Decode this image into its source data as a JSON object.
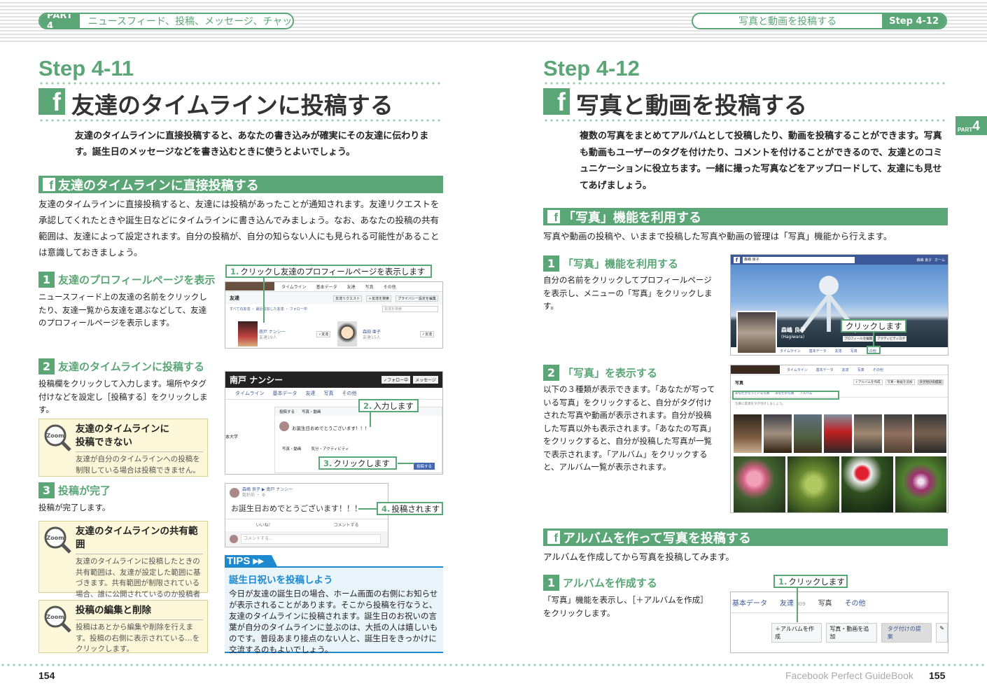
{
  "header": {
    "part_label": "PART 4",
    "left_title": "ニュースフィード、投稿、メッセージ、チャット",
    "right_title": "写真と動画を投稿する",
    "right_step": "Step 4-12"
  },
  "left": {
    "step": "Step 4-11",
    "title": "友達のタイムラインに投稿する",
    "intro": "友達のタイムラインに直接投稿すると、あなたの書き込みが確実にその友達に伝わります。誕生日のメッセージなどを書き込むときに使うとよいでしょう。",
    "section_title": "友達のタイムラインに直接投稿する",
    "section_body": "友達のタイムラインに直接投稿すると、友達には投稿があったことが通知されます。友達リクエストを承認してくれたときや誕生日などにタイムラインに書き込んでみましょう。なお、あなたの投稿の共有範囲は、友達によって設定されます。自分の投稿が、自分の知らない人にも見られる可能性があることは意識しておきましょう。",
    "steps": [
      {
        "num": "1",
        "title": "友達のプロフィールページを表示",
        "body": "ニュースフィード上の友達の名前をクリックしたり、友達一覧から友達を選ぶなどして、友達のプロフィールページを表示します。"
      },
      {
        "num": "2",
        "title": "友達のタイムラインに投稿する",
        "body": "投稿欄をクリックして入力します。場所やタグ付けなどを設定し［投稿する］をクリックします。"
      },
      {
        "num": "3",
        "title": "投稿が完了",
        "body": "投稿が完了します。"
      }
    ],
    "callouts": [
      {
        "num": "1.",
        "text": "クリックし友達のプロフィールページを表示します"
      },
      {
        "num": "2.",
        "text": "入力します"
      },
      {
        "num": "3.",
        "text": "クリックします"
      },
      {
        "num": "4.",
        "text": "投稿されます"
      }
    ],
    "zooms": [
      {
        "title": "友達のタイムラインに投稿できない",
        "title_l1": "友達のタイムラインに",
        "title_l2": "投稿できない",
        "body": "友達が自分のタイムラインへの投稿を制限している場合は投稿できません。"
      },
      {
        "title": "友達のタイムラインの共有範囲",
        "body": "友達のタイムラインに投稿したときの共有範囲は、友達が設定した範囲に基づきます。共有範囲が制限されている場合、誰に公開されているのか投稿者にはわかりません。"
      },
      {
        "title": "投稿の編集と削除",
        "body": "投稿はあとから編集や削除を行えます。投稿の右側に表示されている…をクリックします。"
      }
    ],
    "zoom_label": "Zoom",
    "tips": {
      "label": "TIPS",
      "title": "誕生日祝いを投稿しよう",
      "body": "今日が友達の誕生日の場合、ホーム画面の右側にお知らせが表示されることがあります。そこから投稿を行なうと、友達のタイムラインに投稿されます。誕生日のお祝いの言葉が自分のタイムラインに並ぶのは、大抵の人は嬉しいものです。普段あまり接点のない人と、誕生日をきっかけに交流するのもよいでしょう。"
    },
    "shot1": {
      "tabs": [
        "タイムライン",
        "基本データ",
        "友達",
        "写真",
        "その他"
      ],
      "label": "友達",
      "sub": "すべての友達 ・ 最近追加した友達 ・ フォロー中",
      "buttons": [
        "友達リクエスト",
        "＋友達を検索",
        "プライバシー設定を編集"
      ],
      "search": "友達を検索",
      "friend1": "南戸 ナンシー",
      "friend1_sub": "友達19人",
      "friend2": "森田 亜子",
      "friend2_sub": "友達15人",
      "btn": "✓友達"
    },
    "shot2": {
      "name": "南戸 ナンシー",
      "follow": "✓フォロー中",
      "msg": "メッセージ",
      "tabs": [
        "タイムライン",
        "基本データ",
        "友達",
        "写真",
        "その他"
      ],
      "tab_sub": "共通の友達3人",
      "side": "本大学",
      "post_tabs": [
        "投稿する",
        "写真・動画"
      ],
      "input": "お誕生日おめでとうございます！！！",
      "opts": [
        "写真・動画",
        "気分・アクティビティ"
      ],
      "submit": "投稿する"
    },
    "shot3": {
      "author": "森嶋 良子 ▶ 南戸 ナンシー",
      "meta": "数秒前 ・ ⚙",
      "text": "お誕生日おめでとうございます！！！",
      "like": "いいね！",
      "comment": "コメントする",
      "placeholder": "コメントする..."
    },
    "page_num": "154"
  },
  "right": {
    "step": "Step 4-12",
    "title": "写真と動画を投稿する",
    "tab": "PART",
    "tab_num": "4",
    "intro": "複数の写真をまとめてアルバムとして投稿したり、動画を投稿することができます。写真も動画もユーザーのタグを付けたり、コメントを付けることができるので、友達とのコミュニケーションに役立ちます。一緒に撮った写真などをアップロードして、友達にも見せてあげましょう。",
    "section1": "「写真」機能を利用する",
    "section1_body": "写真や動画の投稿や、いままで投稿した写真や動画の管理は「写真」機能から行えます。",
    "step1": {
      "num": "1",
      "title": "「写真」機能を利用する",
      "body": "自分の名前をクリックしてプロフィールページを表示し、メニューの「写真」をクリックします。"
    },
    "step2": {
      "num": "2",
      "title": "「写真」を表示する",
      "body": "以下の３種類が表示できます。「あなたが写っている写真」をクリックすると、自分がタグ付けされた写真や動画が表示されます。自分が投稿した写真以外も表示されます。「あなたの写真」をクリックすると、自分が投稿した写真が一覧で表示されます。「アルバム」をクリックすると、アルバム一覧が表示されます。"
    },
    "section2": "アルバムを作って写真を投稿する",
    "section2_body": "アルバムを作成してから写真を投稿してみます。",
    "step3": {
      "num": "1",
      "title": "アルバムを作成する",
      "body": "「写真」機能を表示し、［＋アルバムを作成］をクリックします。"
    },
    "shotA": {
      "search": "森嶋 良子",
      "nav": [
        "森嶋 良子",
        "ホーム"
      ],
      "name": "森嶋 良子",
      "name_sub": "(Hagiwara)",
      "btns": [
        "プロフィールを編集",
        "アクティビティログ"
      ],
      "tabs": [
        "タイムライン",
        "基本データ",
        "友達",
        "写真",
        "その他"
      ],
      "callout": "クリックします"
    },
    "shotB": {
      "tabs": [
        "タイムライン",
        "基本データ",
        "友達",
        "写真",
        "その他"
      ],
      "label": "写真",
      "buttons": [
        "＋アルバムを作成",
        "写真・動画を追加",
        "タグ付けの提案"
      ],
      "filters": [
        "あなたが写っている写真",
        "あなたの写真",
        "アルバム"
      ],
      "note": "写真に友達をタグ付けしましょう。"
    },
    "shotC": {
      "tabs": [
        "基本データ",
        "友達",
        "写真",
        "その他"
      ],
      "friend_count": "309",
      "buttons": [
        "＋アルバムを作成",
        "写真・動画を追加",
        "タグ付けの提案"
      ],
      "callout_num": "1.",
      "callout": "クリックします"
    },
    "page_num": "155",
    "footer": "Facebook Perfect GuideBook"
  },
  "colors": {
    "accent": "#5aa676",
    "facebook": "#3b5998",
    "tips": "#1d8ad0",
    "zoom_bg": "#fbf7d8"
  }
}
